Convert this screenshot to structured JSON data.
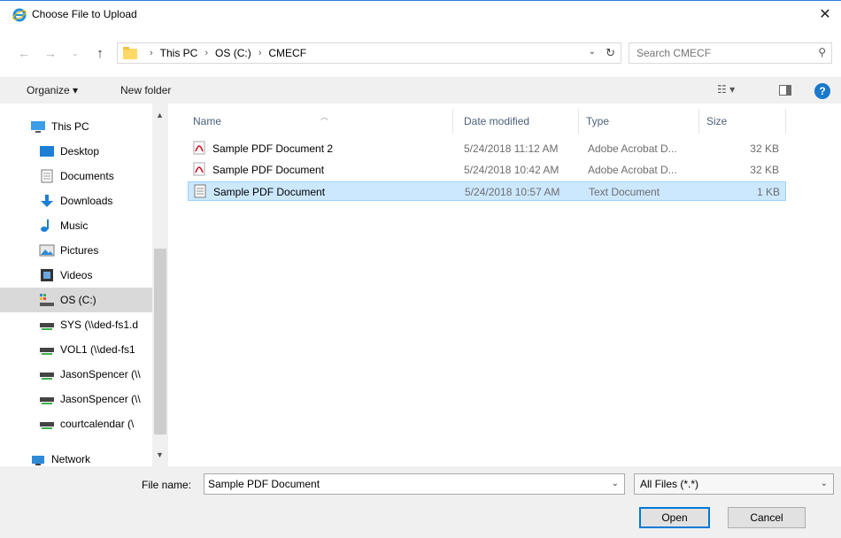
{
  "window": {
    "title": "Choose File to Upload",
    "close_glyph": "✕"
  },
  "address": {
    "crumbs": [
      "This PC",
      "OS (C:)",
      "CMECF"
    ],
    "search_placeholder": "Search CMECF"
  },
  "toolbar": {
    "organize_label": "Organize ▾",
    "new_folder_label": "New folder",
    "help_glyph": "?"
  },
  "nav": {
    "items": [
      {
        "label": "This PC",
        "icon": "pc-icon"
      },
      {
        "label": "Desktop",
        "icon": "desktop-icon"
      },
      {
        "label": "Documents",
        "icon": "documents-icon"
      },
      {
        "label": "Downloads",
        "icon": "downloads-icon"
      },
      {
        "label": "Music",
        "icon": "music-icon"
      },
      {
        "label": "Pictures",
        "icon": "pictures-icon"
      },
      {
        "label": "Videos",
        "icon": "videos-icon"
      },
      {
        "label": "OS (C:)",
        "icon": "drive-icon"
      },
      {
        "label": "SYS (\\\\ded-fs1.d",
        "icon": "network-drive-icon"
      },
      {
        "label": "VOL1 (\\\\ded-fs1",
        "icon": "network-drive-icon"
      },
      {
        "label": "JasonSpencer (\\\\",
        "icon": "network-drive-icon"
      },
      {
        "label": "JasonSpencer (\\\\",
        "icon": "network-drive-icon"
      },
      {
        "label": "courtcalendar (\\",
        "icon": "network-drive-icon"
      },
      {
        "label": "Network",
        "icon": "network-icon"
      }
    ],
    "selected_index": 7
  },
  "filelist": {
    "columns": [
      "Name",
      "Date modified",
      "Type",
      "Size"
    ],
    "rows": [
      {
        "name": "Sample PDF Document 2",
        "date": "5/24/2018 11:12 AM",
        "type": "Adobe Acrobat D...",
        "size": "32 KB",
        "icon": "pdf-icon"
      },
      {
        "name": "Sample PDF Document",
        "date": "5/24/2018 10:42 AM",
        "type": "Adobe Acrobat D...",
        "size": "32 KB",
        "icon": "pdf-icon"
      },
      {
        "name": "Sample PDF Document",
        "date": "5/24/2018 10:57 AM",
        "type": "Text Document",
        "size": "1 KB",
        "icon": "text-file-icon"
      }
    ],
    "selected_row": 2
  },
  "bottom": {
    "filename_label": "File name:",
    "filename_value": "Sample PDF Document",
    "filetype_value": "All Files (*.*)",
    "open_label": "Open",
    "cancel_label": "Cancel"
  }
}
